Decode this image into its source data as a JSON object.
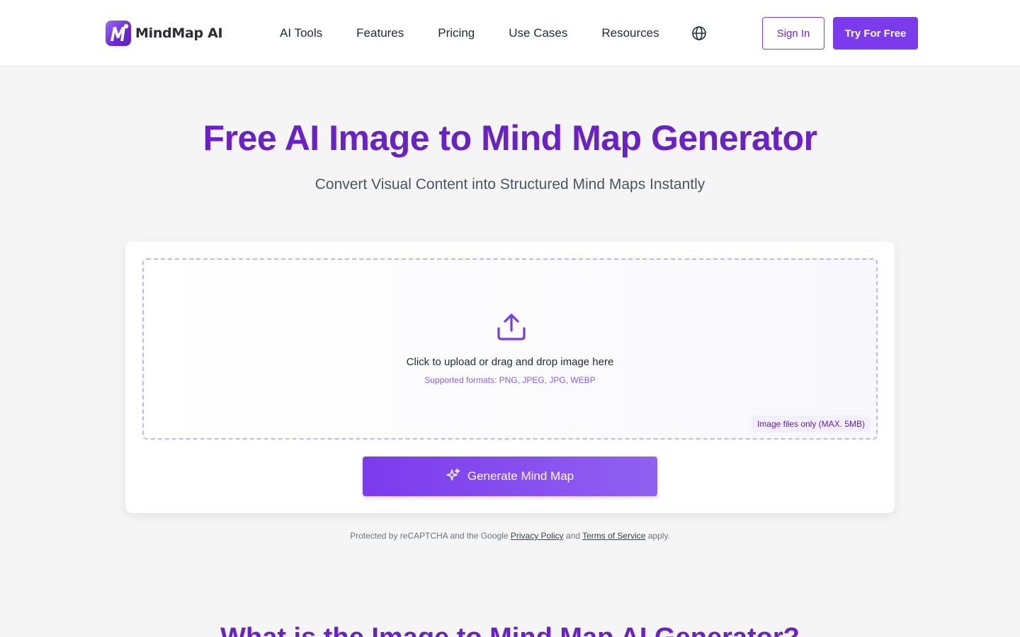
{
  "brand": {
    "name": "MindMap AI",
    "accent": "#7c3aed",
    "title_color": "#6b21c8"
  },
  "nav": {
    "items": [
      {
        "label": "AI Tools"
      },
      {
        "label": "Features"
      },
      {
        "label": "Pricing"
      },
      {
        "label": "Use Cases"
      },
      {
        "label": "Resources"
      }
    ],
    "language_icon": "globe-icon",
    "sign_in": "Sign In",
    "try_free": "Try For Free"
  },
  "hero": {
    "title": "Free AI Image to Mind Map Generator",
    "subtitle": "Convert Visual Content into Structured Mind Maps Instantly"
  },
  "upload": {
    "icon": "upload-icon",
    "prompt": "Click to upload or drag and drop image here",
    "formats": "Supported formats: PNG, JPEG, JPG, WEBP",
    "limit": "Image files only (MAX. 5MB)"
  },
  "generate": {
    "icon": "sparkles-icon",
    "label": "Generate Mind Map"
  },
  "recaptcha": {
    "prefix": "Protected by reCAPTCHA and the Google",
    "privacy": "Privacy Policy",
    "and": "and",
    "terms": "Terms of Service",
    "suffix": "apply."
  },
  "next_section": {
    "title": "What is the Image to Mind Map AI Generator?"
  }
}
